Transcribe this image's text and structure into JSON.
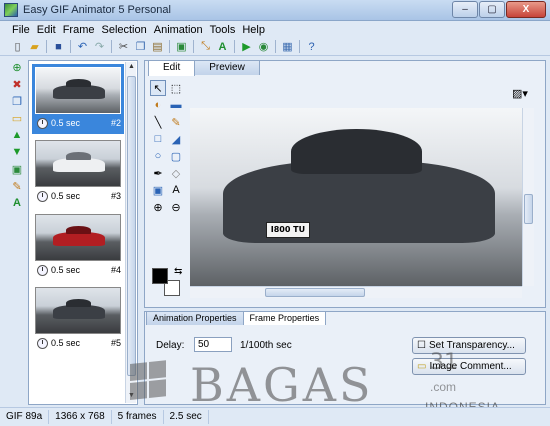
{
  "window": {
    "title": "Easy GIF Animator 5 Personal",
    "buttons": [
      "–",
      "▢",
      "X"
    ]
  },
  "menu": [
    "File",
    "Edit",
    "Frame",
    "Selection",
    "Animation",
    "Tools",
    "Help"
  ],
  "toolbar_icons": [
    "new-icon",
    "open-icon",
    "save-icon",
    "undo-icon",
    "redo-icon",
    "cut-icon",
    "copy-icon",
    "paste-icon",
    "crop-icon",
    "resize-icon",
    "text-effect-icon",
    "play-icon",
    "preview-browser-icon",
    "export-icon",
    "help-icon"
  ],
  "frames": [
    {
      "duration": "0.5 sec",
      "number": "#2",
      "selected": true,
      "scene": "snow"
    },
    {
      "duration": "0.5 sec",
      "number": "#3",
      "selected": false,
      "scene": "white"
    },
    {
      "duration": "0.5 sec",
      "number": "#4",
      "selected": false,
      "scene": "red"
    },
    {
      "duration": "0.5 sec",
      "number": "#5",
      "selected": false,
      "scene": "dark"
    }
  ],
  "editor": {
    "tabs": [
      "Edit",
      "Preview"
    ],
    "active_tab": "Edit",
    "plate_text": "I800 TU"
  },
  "properties": {
    "tabs": [
      "Animation Properties",
      "Frame Properties"
    ],
    "active_tab": "Frame Properties",
    "delay_label": "Delay:",
    "delay_value": "50",
    "delay_unit": "1/100th sec",
    "set_transparency": "Set Transparency...",
    "image_comment": "Image Comment..."
  },
  "status": [
    "GIF 89a",
    "1366 x 768",
    "5 frames",
    "2.5 sec"
  ],
  "watermark": {
    "text": "BAGAS",
    "number": "31",
    "domain": ".com",
    "country": "INDONESIA"
  },
  "colors": {
    "selection": "#3a86dc",
    "foreground": "#000000",
    "background": "#ffffff"
  }
}
